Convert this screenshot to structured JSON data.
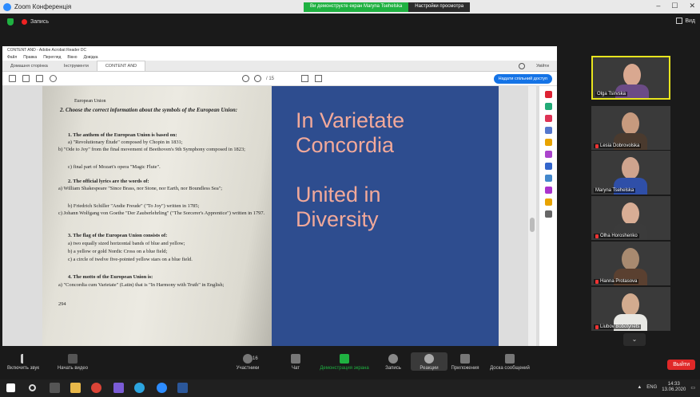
{
  "zoom": {
    "window_title": "Zoom Конференція",
    "share_banner": "Ви демонструєте екран Maryna Tsehelska",
    "share_options": "Настройки просмотра",
    "recording_label": "Запись",
    "view_label": "Вид"
  },
  "acrobat": {
    "title": "CONTENT AND - Adobe Acrobat Reader DC",
    "menu": [
      "Файл",
      "Правка",
      "Перегляд",
      "Вікно",
      "Довідка"
    ],
    "tabs": [
      "Домашня сторінка",
      "Інструменти",
      "CONTENT AND"
    ],
    "sign_in": "Увійти",
    "page_indicator": "/ 15",
    "share_link": "Надати спільний доступ"
  },
  "document": {
    "heading_fragment": "European Union",
    "q2_title": "2. Choose the correct information about the symbols of the European Union:",
    "item1_title": "1. The anthem of the European Union is based on:",
    "item1_a": "a) \"Revolutionary Étude\" composed by Chopin in 1831;",
    "item1_b": "b) \"Ode to Joy\" from the final movement of Beethoven's 9th Symphony composed in 1823;",
    "item1_c": "c) final part of Mozart's opera \"Magic Flute\".",
    "item2_title": "2. The official lyrics are the words of:",
    "item2_a": "a) William Shakespeare \"Since Brass, nor Stone, nor Earth, nor Boundless Sea\";",
    "item2_b": "b) Friedrich Schiller \"Andie Freude\" (\"To Joy\") written in 1785;",
    "item2_c": "c) Johann Wolfgang von Goethe \"Der Zauberlehrling\" (\"The Sorcerer's Apprentice\") written in 1797.",
    "item3_title": "3. The flag of the European Union consists of:",
    "item3_a": "a) two equally sized horizontal bands of blue and yellow;",
    "item3_b": "b) a yellow or gold Nordic Cross on a blue field;",
    "item3_c": "c) a circle of twelve five-pointed yellow stars on a blue field.",
    "item4_title": "4. The motto of the European Union is:",
    "item4_a": "a) \"Concordia cum Varietate\" (Latin) that is \"In Harmony with Truth\" in English;",
    "page_number": "294"
  },
  "slide": {
    "line1": "In Varietate",
    "line2": "Concordia",
    "line3": "United in",
    "line4": "Diversity"
  },
  "participants": [
    {
      "name": "Olga Tsirvska",
      "muted": true
    },
    {
      "name": "Lesia Dobrovolska",
      "muted": true
    },
    {
      "name": "Maryna Tsehelska",
      "muted": false
    },
    {
      "name": "Olha Horoshenko",
      "muted": true
    },
    {
      "name": "Hanna Protasova",
      "muted": true
    },
    {
      "name": "Liubov Bobotynets",
      "muted": true
    }
  ],
  "toolbar": {
    "mute": "Включить звук",
    "video": "Начать видео",
    "participants": "Участники",
    "participants_count": "16",
    "chat": "Чат",
    "share": "Демонстрация экрана",
    "record": "Запись",
    "reactions": "Реакции",
    "breakout": "Приложения",
    "whiteboard": "Доска сообщений",
    "leave": "Выйти"
  },
  "taskbar": {
    "lang": "ENG",
    "time": "14:33",
    "date": "13.06.2020"
  }
}
